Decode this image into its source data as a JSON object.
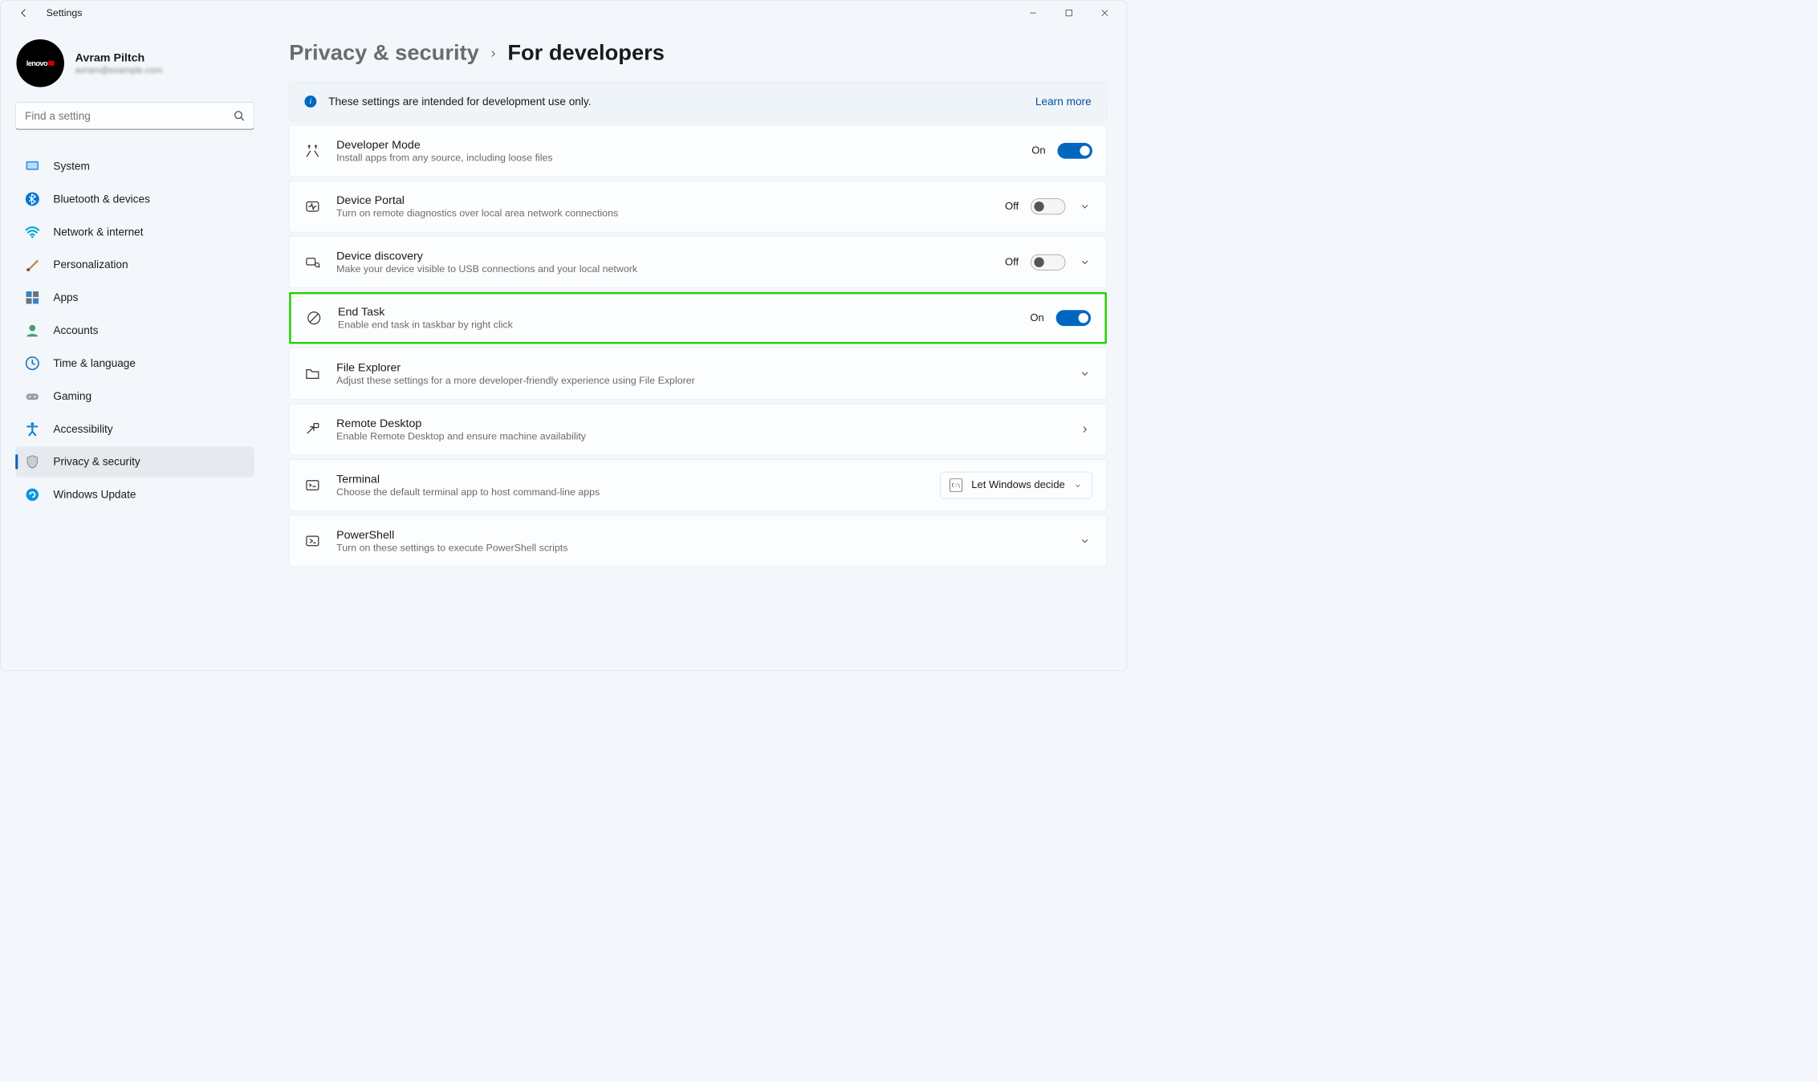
{
  "app_title": "Settings",
  "profile": {
    "name": "Avram Piltch",
    "email": "avram@example.com",
    "avatar_brand": "lenovo"
  },
  "search": {
    "placeholder": "Find a setting"
  },
  "sidebar": {
    "items": [
      {
        "label": "System",
        "icon": "monitor"
      },
      {
        "label": "Bluetooth & devices",
        "icon": "bluetooth"
      },
      {
        "label": "Network & internet",
        "icon": "wifi"
      },
      {
        "label": "Personalization",
        "icon": "brush"
      },
      {
        "label": "Apps",
        "icon": "grid"
      },
      {
        "label": "Accounts",
        "icon": "person"
      },
      {
        "label": "Time & language",
        "icon": "clock"
      },
      {
        "label": "Gaming",
        "icon": "gamepad"
      },
      {
        "label": "Accessibility",
        "icon": "accessibility"
      },
      {
        "label": "Privacy & security",
        "icon": "shield",
        "active": true
      },
      {
        "label": "Windows Update",
        "icon": "update"
      }
    ]
  },
  "breadcrumb": {
    "parent": "Privacy & security",
    "current": "For developers"
  },
  "banner": {
    "text": "These settings are intended for development use only.",
    "link": "Learn more"
  },
  "cards": {
    "developer_mode": {
      "title": "Developer Mode",
      "sub": "Install apps from any source, including loose files",
      "state": "On",
      "toggle": true
    },
    "device_portal": {
      "title": "Device Portal",
      "sub": "Turn on remote diagnostics over local area network connections",
      "state": "Off",
      "toggle": false,
      "expandable": true
    },
    "device_discovery": {
      "title": "Device discovery",
      "sub": "Make your device visible to USB connections and your local network",
      "state": "Off",
      "toggle": false,
      "expandable": true
    },
    "end_task": {
      "title": "End Task",
      "sub": "Enable end task in taskbar by right click",
      "state": "On",
      "toggle": true,
      "highlight": true
    },
    "file_explorer": {
      "title": "File Explorer",
      "sub": "Adjust these settings for a more developer-friendly experience using File Explorer",
      "expandable": true
    },
    "remote_desktop": {
      "title": "Remote Desktop",
      "sub": "Enable Remote Desktop and ensure machine availability",
      "nav": true
    },
    "terminal": {
      "title": "Terminal",
      "sub": "Choose the default terminal app to host command-line apps",
      "dropdown_value": "Let Windows decide"
    },
    "powershell": {
      "title": "PowerShell",
      "sub": "Turn on these settings to execute PowerShell scripts",
      "expandable": true
    }
  }
}
